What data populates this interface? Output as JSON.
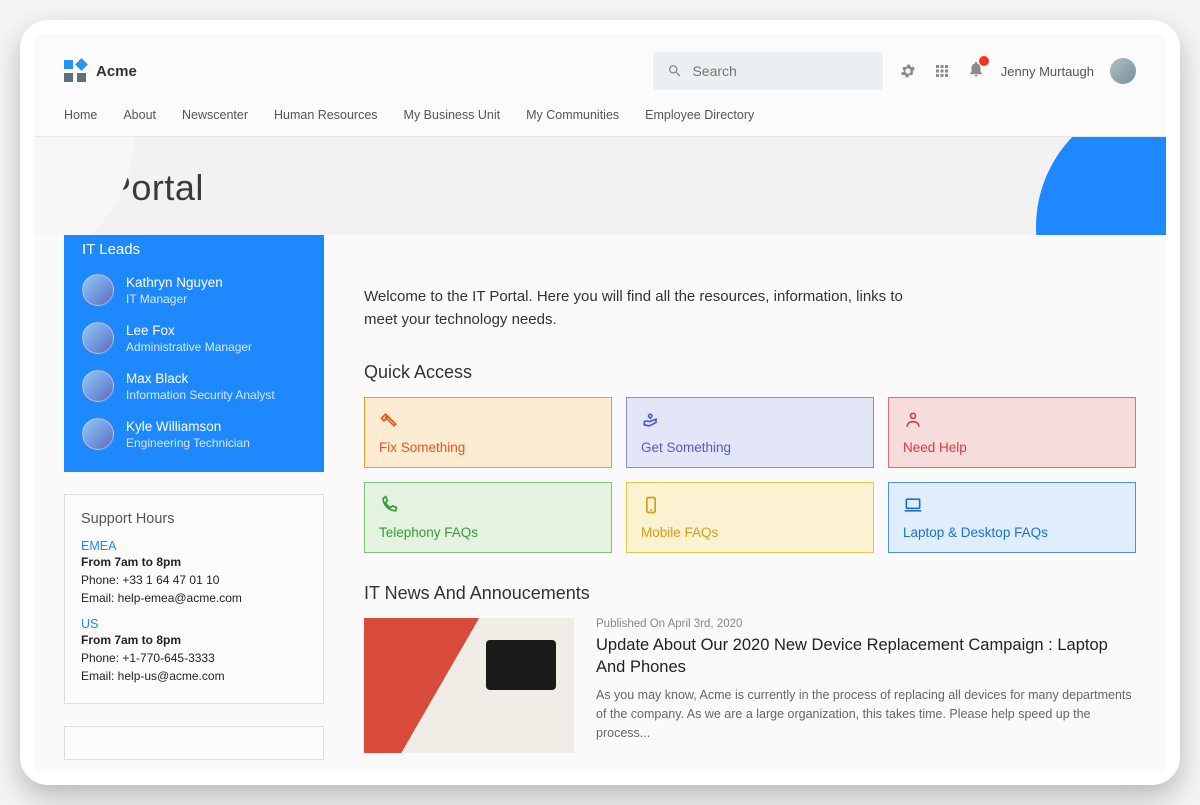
{
  "brand": {
    "name": "Acme"
  },
  "search": {
    "placeholder": "Search"
  },
  "user": {
    "name": "Jenny Murtaugh"
  },
  "nav": {
    "home": "Home",
    "about": "About",
    "newscenter": "Newscenter",
    "hr": "Human Resources",
    "business_unit": "My Business Unit",
    "communities": "My Communities",
    "directory": "Employee Directory"
  },
  "page": {
    "title": "IT Portal"
  },
  "leads": {
    "heading": "IT Leads",
    "items": [
      {
        "name": "Kathryn Nguyen",
        "role": "IT Manager"
      },
      {
        "name": "Lee Fox",
        "role": "Administrative Manager"
      },
      {
        "name": "Max Black",
        "role": "Information Security Analyst"
      },
      {
        "name": "Kyle Williamson",
        "role": "Engineering Technician"
      }
    ]
  },
  "support": {
    "heading": "Support Hours",
    "emea": {
      "label": "EMEA",
      "hours": "From 7am to 8pm",
      "phone": "Phone: +33 1 64 47 01 10",
      "email": "Email: help-emea@acme.com"
    },
    "us": {
      "label": "US",
      "hours": "From 7am to 8pm",
      "phone": "Phone: +1-770-645-3333",
      "email": "Email: help-us@acme.com"
    }
  },
  "welcome": "Welcome to the IT Portal. Here you will find all the resources, information, links to meet your technology needs.",
  "quick_access": {
    "heading": "Quick Access",
    "fix": "Fix Something",
    "get": "Get Something",
    "help": "Need Help",
    "telephony": "Telephony FAQs",
    "mobile": "Mobile FAQs",
    "laptop": "Laptop & Desktop FAQs"
  },
  "news": {
    "heading": "IT News And Annoucements",
    "item": {
      "meta": "Published  On  April 3rd, 2020",
      "title": "Update About Our 2020 New Device Replacement Campaign : Laptop And Phones",
      "excerpt": "As you may know, Acme is currently in the process of replacing all devices for many departments of the company. As we are a large organization, this takes time. Please help speed up the process..."
    }
  },
  "colors": {
    "fix": {
      "border": "#f39b2b",
      "bg": "#fdebd2",
      "text": "#e5541d"
    },
    "get": {
      "border": "#7e8fe0",
      "bg": "#e3e6f7",
      "text": "#4f5bd5"
    },
    "help": {
      "border": "#e76c6c",
      "bg": "#f7dcdc",
      "text": "#d63c3c"
    },
    "tel": {
      "border": "#7cc47c",
      "bg": "#e4f2e0",
      "text": "#3a9a3a"
    },
    "mob": {
      "border": "#e8c24b",
      "bg": "#fbf2d2",
      "text": "#d89b1a"
    },
    "lap": {
      "border": "#4f8fe0",
      "bg": "#e0edfa",
      "text": "#1e6fd6"
    }
  }
}
